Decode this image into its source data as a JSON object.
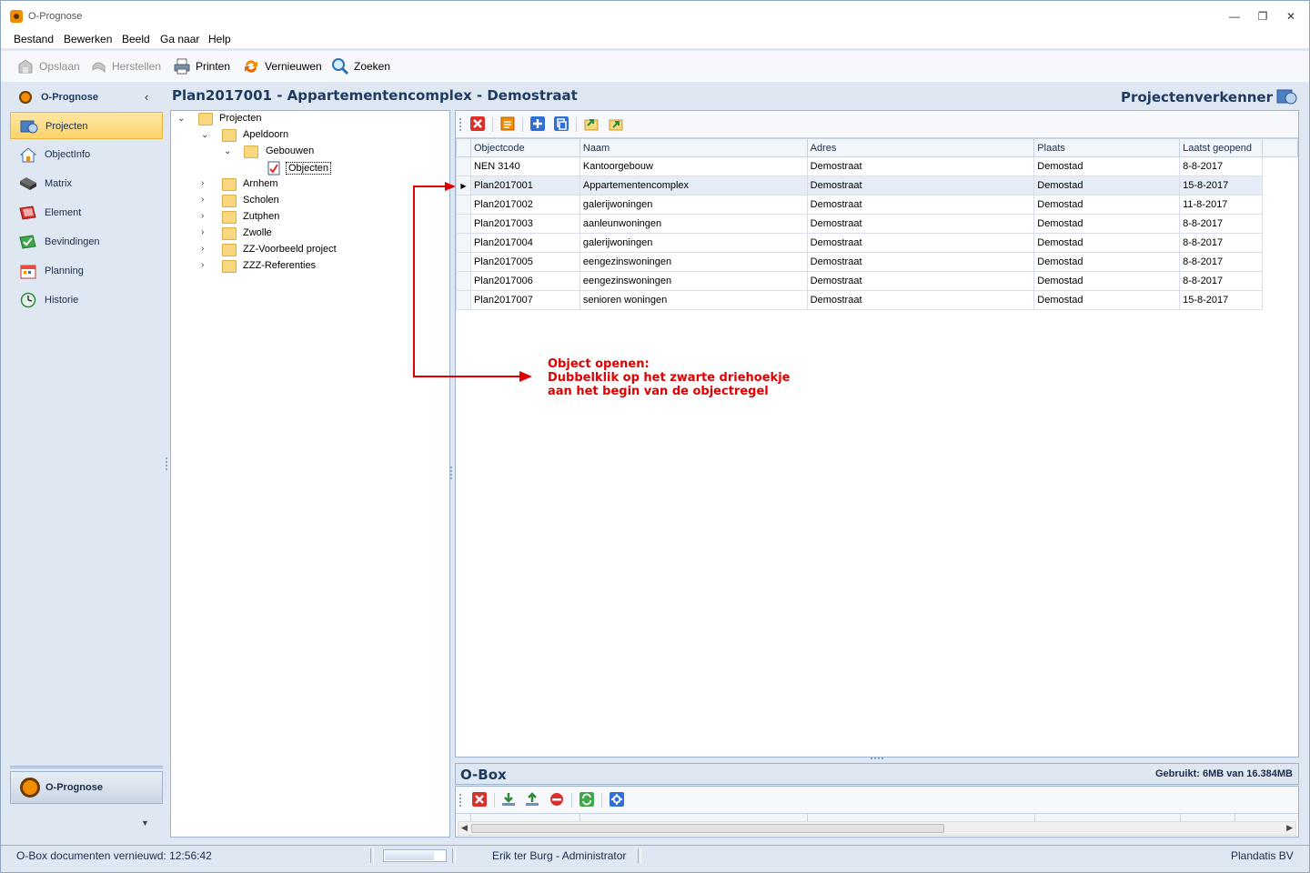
{
  "window": {
    "title": "O-Prognose",
    "controls": [
      "minimize",
      "maximize",
      "close"
    ]
  },
  "menu": [
    "Bestand",
    "Bewerken",
    "Beeld",
    "Ga naar",
    "Help"
  ],
  "toolbar": {
    "save": "Opslaan",
    "restore": "Herstellen",
    "print": "Printen",
    "refresh": "Vernieuwen",
    "search": "Zoeken"
  },
  "nav": {
    "header": "O-Prognose",
    "items": [
      {
        "label": "Projecten",
        "icon": "projects-icon",
        "active": true
      },
      {
        "label": "ObjectInfo",
        "icon": "house-icon",
        "active": false
      },
      {
        "label": "Matrix",
        "icon": "matrix-icon",
        "active": false
      },
      {
        "label": "Element",
        "icon": "element-icon",
        "active": false
      },
      {
        "label": "Bevindingen",
        "icon": "findings-icon",
        "active": false
      },
      {
        "label": "Planning",
        "icon": "calendar-icon",
        "active": false
      },
      {
        "label": "Historie",
        "icon": "history-icon",
        "active": false
      }
    ],
    "bottom": "O-Prognose"
  },
  "header": {
    "doc_title": "Plan2017001 - Appartementencomplex - Demostraat",
    "explorer": "Projectenverkenner"
  },
  "tree": [
    {
      "label": "Projecten",
      "level": 0,
      "expanded": true
    },
    {
      "label": "Apeldoorn",
      "level": 1,
      "expanded": true
    },
    {
      "label": "Gebouwen",
      "level": 2,
      "expanded": true
    },
    {
      "label": "Objecten",
      "level": 3,
      "selected": true
    },
    {
      "label": "Arnhem",
      "level": 1,
      "expanded": false
    },
    {
      "label": "Scholen",
      "level": 1,
      "expanded": false
    },
    {
      "label": "Zutphen",
      "level": 1,
      "expanded": false
    },
    {
      "label": "Zwolle",
      "level": 1,
      "expanded": false
    },
    {
      "label": "ZZ-Voorbeeld project",
      "level": 1,
      "expanded": false
    },
    {
      "label": "ZZZ-Referenties",
      "level": 1,
      "expanded": false
    }
  ],
  "grid": {
    "columns": [
      "Objectcode",
      "Naam",
      "Adres",
      "Plaats",
      "Laatst geopend"
    ],
    "rows": [
      [
        "NEN 3140",
        "Kantoorgebouw",
        "Demostraat",
        "Demostad",
        "8-8-2017"
      ],
      [
        "Plan2017001",
        "Appartementencomplex",
        "Demostraat",
        "Demostad",
        "15-8-2017"
      ],
      [
        "Plan2017002",
        "galerijwoningen",
        "Demostraat",
        "Demostad",
        "11-8-2017"
      ],
      [
        "Plan2017003",
        "aanleunwoningen",
        "Demostraat",
        "Demostad",
        "8-8-2017"
      ],
      [
        "Plan2017004",
        "galerijwoningen",
        "Demostraat",
        "Demostad",
        "8-8-2017"
      ],
      [
        "Plan2017005",
        "eengezinswoningen",
        "Demostraat",
        "Demostad",
        "8-8-2017"
      ],
      [
        "Plan2017006",
        "eengezinswoningen",
        "Demostraat",
        "Demostad",
        "8-8-2017"
      ],
      [
        "Plan2017007",
        "senioren woningen",
        "Demostraat",
        "Demostad",
        "15-8-2017"
      ]
    ],
    "current_row": 1
  },
  "annotation": {
    "line1": "Object openen:",
    "line2": "Dubbelklik op het zwarte driehoekje",
    "line3": "aan het begin van de objectregel",
    "color": "#e00000"
  },
  "obox": {
    "title": "O-Box",
    "usage": "Gebruikt: 6MB van 16.384MB"
  },
  "status": {
    "left": "O-Box documenten vernieuwd: 12:56:42",
    "user": "Erik ter Burg - Administrator",
    "company": "Plandatis BV"
  }
}
